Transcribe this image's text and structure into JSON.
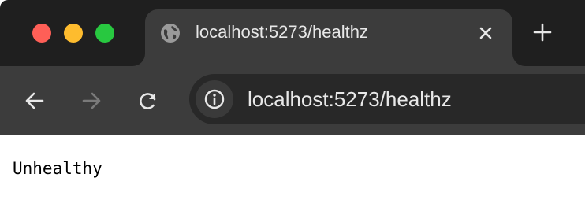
{
  "window": {
    "controls": {
      "close_color": "#fe5f57",
      "minimize_color": "#febc2e",
      "zoom_color": "#28c840"
    }
  },
  "tab": {
    "title": "localhost:5273/healthz",
    "favicon_icon": "globe-icon",
    "close_icon": "close-icon"
  },
  "new_tab_icon": "plus-icon",
  "toolbar": {
    "back_icon": "arrow-left-icon",
    "forward_icon": "arrow-right-icon",
    "reload_icon": "reload-icon",
    "forward_enabled": false
  },
  "omnibox": {
    "site_info_icon": "info-icon",
    "url": "localhost:5273/healthz"
  },
  "page": {
    "body_text": "Unhealthy"
  },
  "colors": {
    "tabstrip_bg": "#1f1f1f",
    "toolbar_bg": "#3c3c3c",
    "omnibox_bg": "#282828",
    "content_bg": "#ffffff"
  }
}
